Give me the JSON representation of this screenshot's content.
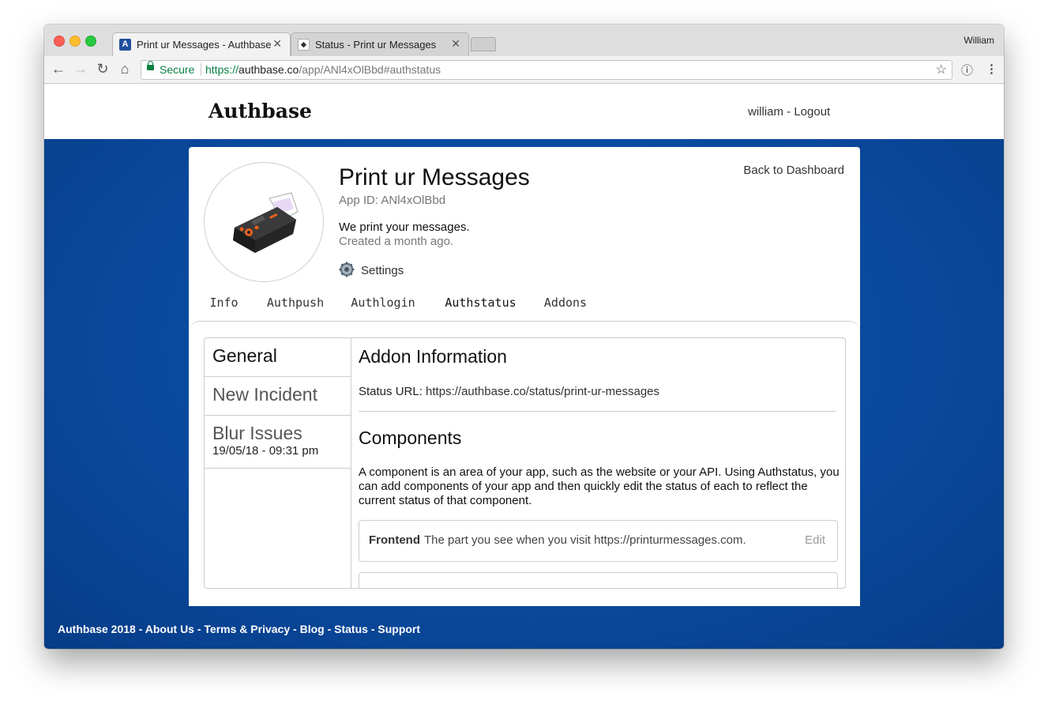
{
  "browser": {
    "profile_name": "William",
    "tabs": [
      {
        "title": "Print ur Messages - Authbase",
        "favicon": "A"
      },
      {
        "title": "Status - Print ur Messages",
        "favicon": "status-favicon"
      }
    ],
    "secure_label": "Secure",
    "url_scheme": "https://",
    "url_host": "authbase.co",
    "url_path": "/app/ANl4xOlBbd#authstatus"
  },
  "header": {
    "logo": "Authbase",
    "username": "william",
    "separator": " - ",
    "logout": "Logout"
  },
  "app": {
    "name": "Print ur Messages",
    "app_id": "App ID: ANl4xOlBbd",
    "description": "We print your messages.",
    "created": "Created a month ago.",
    "settings_label": "Settings",
    "back_link": "Back to Dashboard"
  },
  "tabs": [
    {
      "label": "Info"
    },
    {
      "label": "Authpush"
    },
    {
      "label": "Authlogin"
    },
    {
      "label": "Authstatus",
      "active": true
    },
    {
      "label": "Addons"
    }
  ],
  "sidebar": {
    "items": [
      {
        "title": "General"
      },
      {
        "title": "New Incident"
      },
      {
        "title": "Blur Issues",
        "date": "19/05/18 - 09:31 pm"
      }
    ]
  },
  "panel": {
    "addon_heading": "Addon Information",
    "status_url_label": "Status URL: ",
    "status_url": "https://authbase.co/status/print-ur-messages",
    "components_heading": "Components",
    "components_desc": "A component is an area of your app, such as the website or your API. Using Authstatus, you can add components of your app and then quickly edit the status of each to reflect the current status of that component.",
    "components": [
      {
        "name": "Frontend",
        "text": "The part you see when you visit https://printurmessages.com.",
        "edit": "Edit"
      }
    ]
  },
  "footer": {
    "copyright": "Authbase 2018",
    "links": [
      "About Us",
      "Terms & Privacy",
      "Blog",
      "Status",
      "Support"
    ]
  },
  "colors": {
    "brand_blue": "#0a4a9e",
    "active_tab_underline": "#1456a8",
    "secure_green": "#0b8043"
  }
}
